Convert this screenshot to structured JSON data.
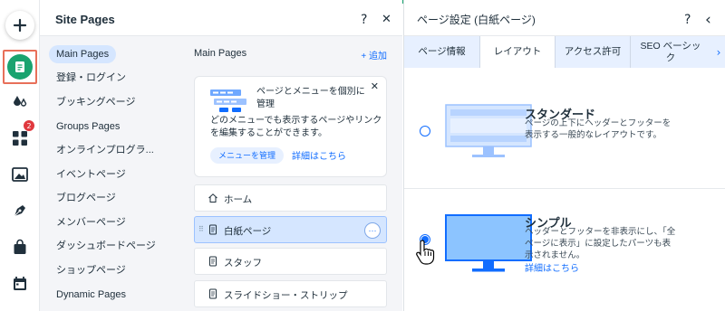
{
  "rail": {
    "items": [
      {
        "icon": "plus-icon"
      },
      {
        "icon": "page-icon"
      },
      {
        "icon": "paint-drop-icon"
      },
      {
        "icon": "apps-grid-icon",
        "badge": "2"
      },
      {
        "icon": "image-icon"
      },
      {
        "icon": "pen-nib-icon"
      },
      {
        "icon": "shopping-bag-icon"
      },
      {
        "icon": "calendar-icon"
      }
    ]
  },
  "site_pages": {
    "title": "Site Pages",
    "help": "?",
    "close": "✕",
    "menus": [
      {
        "label": "Main Pages",
        "active": true
      },
      {
        "label": "登録・ログイン"
      },
      {
        "label": "ブッキングページ"
      },
      {
        "label": "Groups Pages"
      },
      {
        "label": "オンラインプログラ..."
      },
      {
        "label": "イベントページ"
      },
      {
        "label": "ブログページ"
      },
      {
        "label": "メンバーページ"
      },
      {
        "label": "ダッシュボードページ"
      },
      {
        "label": "ショップページ"
      },
      {
        "label": "Dynamic Pages"
      }
    ],
    "pages_heading": "Main Pages",
    "add_label": "+ 追加",
    "info_card": {
      "title": "ページとメニューを個別に管理",
      "body": "どのメニューでも表示するページやリンクを編集することができます。",
      "button": "メニューを管理",
      "link": "詳細はこちら",
      "close": "✕"
    },
    "pages": [
      {
        "label": "ホーム",
        "icon": "home-icon"
      },
      {
        "label": "白紙ページ",
        "icon": "page-icon",
        "selected": true
      },
      {
        "label": "スタッフ",
        "icon": "page-icon"
      },
      {
        "label": "スライドショー・ストリップ",
        "icon": "page-icon"
      }
    ],
    "more": "···"
  },
  "settings": {
    "title": "ページ設定 (白紙ページ)",
    "help": "?",
    "back": "‹",
    "tabs": [
      "ページ情報",
      "レイアウト",
      "アクセス許可",
      "SEO ベーシック"
    ],
    "active_tab": 1,
    "tabs_more": "›",
    "layouts": [
      {
        "title": "スタンダード",
        "desc": "ページの上下にヘッダーとフッターを表示する一般的なレイアウトです。",
        "selected": false
      },
      {
        "title": "シンプル",
        "desc": "ヘッダーとフッターを非表示にし、「全ページに表示」に設定したパーツも表示されません。",
        "link": "詳細はこちら",
        "selected": true
      }
    ]
  },
  "colors": {
    "accent": "#116dff",
    "green": "#1aa36f",
    "highlight": "#e8705a",
    "badge": "#e0383e"
  }
}
